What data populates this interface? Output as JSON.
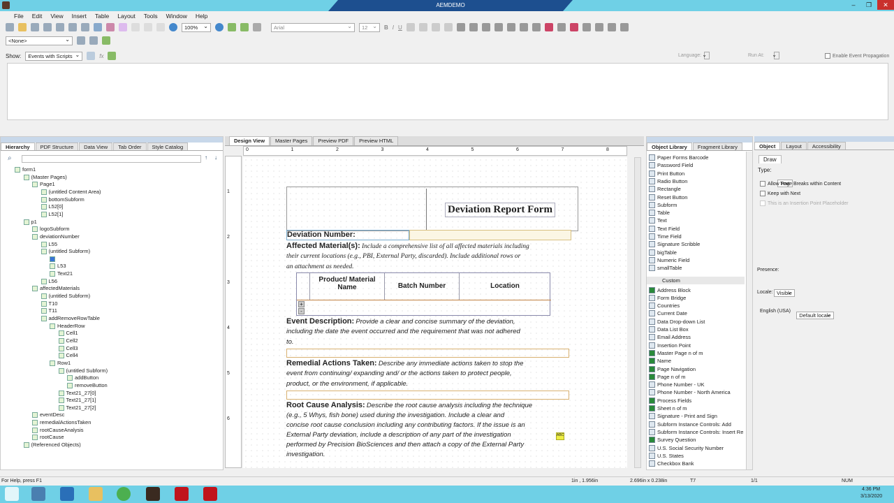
{
  "titlebar": {
    "title": "AEMDEMO"
  },
  "menu": [
    "File",
    "Edit",
    "View",
    "Insert",
    "Table",
    "Layout",
    "Tools",
    "Window",
    "Help"
  ],
  "toolbar": {
    "zoom": "100%",
    "font": "Arial",
    "font_size": "12",
    "bold": "B",
    "italic": "I",
    "underline": "U"
  },
  "toolbar2": {
    "style_select": "<None>"
  },
  "script_bar": {
    "show_label": "Show:",
    "show_value": "Events with Scripts",
    "language_label": "Language:",
    "run_at_label": "Run At:",
    "enable_propagation": "Enable Event Propagation"
  },
  "hierarchy": {
    "tabs": [
      "Hierarchy",
      "PDF Structure",
      "Data View",
      "Tab Order",
      "Style Catalog"
    ],
    "items": [
      [
        "form1",
        0
      ],
      [
        "(Master Pages)",
        1
      ],
      [
        "Page1",
        2
      ],
      [
        "(untitled Content Area)",
        3
      ],
      [
        "bottomSubform",
        3
      ],
      [
        "L52[0]",
        3
      ],
      [
        "L52[1]",
        3
      ],
      [
        "p1",
        1
      ],
      [
        "logoSubform",
        2
      ],
      [
        "deviationNumber",
        2
      ],
      [
        "L55",
        3
      ],
      [
        "(untitled Subform)",
        3
      ],
      [
        "",
        4
      ],
      [
        "L53",
        4
      ],
      [
        "Text21",
        4
      ],
      [
        "L56",
        3
      ],
      [
        "affectedMaterials",
        2
      ],
      [
        "(untitled Subform)",
        3
      ],
      [
        "T10",
        3
      ],
      [
        "T11",
        3
      ],
      [
        "addRemoveRowTable",
        3
      ],
      [
        "HeaderRow",
        4
      ],
      [
        "Cell1",
        5
      ],
      [
        "Cell2",
        5
      ],
      [
        "Cell3",
        5
      ],
      [
        "Cell4",
        5
      ],
      [
        "Row1",
        4
      ],
      [
        "(untitled Subform)",
        5
      ],
      [
        "addButton",
        6
      ],
      [
        "removeButton",
        6
      ],
      [
        "Text21_27[0]",
        5
      ],
      [
        "Text21_27[1]",
        5
      ],
      [
        "Text21_27[2]",
        5
      ],
      [
        "eventDesc",
        2
      ],
      [
        "remedialActionsTaken",
        2
      ],
      [
        "rootCauseAnalysis",
        2
      ],
      [
        "rootCause",
        2
      ],
      [
        "(Referenced Objects)",
        1
      ]
    ]
  },
  "design": {
    "tabs": [
      "Design View",
      "Master Pages",
      "Preview PDF",
      "Preview HTML"
    ],
    "ruler": [
      "0",
      "1",
      "2",
      "3",
      "4",
      "5",
      "6",
      "7",
      "8"
    ],
    "vruler": [
      "1",
      "2",
      "3",
      "4",
      "5",
      "6"
    ]
  },
  "form": {
    "title": "Deviation Report Form",
    "deviation_number": "Deviation Number:",
    "affected_label": "Affected Material(s):",
    "affected_text": [
      "Include a comprehensive list of all affected materials including",
      "their current locations (e.g., PBI, External Party, discarded).  Include additional rows or",
      "an attachment as needed."
    ],
    "table_headers": [
      "Product/ Material Name",
      "Batch Number",
      "Location"
    ],
    "add_btn": "+",
    "remove_btn": "-",
    "event_label": "Event Description:",
    "event_text": [
      "Provide a clear and concise summary of the deviation,",
      "including the date the event occurred and the requirement that was not adhered",
      "to."
    ],
    "remedial_label": "Remedial Actions Taken:",
    "remedial_text": [
      "Describe any immediate actions taken to stop the",
      "event from continuing/ expanding and/ or the actions taken to protect people,",
      "product, or the environment, if applicable."
    ],
    "root_label": "Root Cause Analysis:",
    "root_text": [
      "Describe the root cause analysis including the technique",
      "(e.g., 5 Whys, fish bone) used during the investigation.  Include a clear and",
      "concise root cause conclusion including any contributing factors.  If the issue is an",
      "External Party deviation, include a description of any part of the investigation",
      "performed by Precision BioSciences and then attach a copy of the External Party",
      "investigation."
    ],
    "spell_badge": "ABC"
  },
  "object_library": {
    "tabs": [
      "Object Library",
      "Fragment Library"
    ],
    "standard": [
      "Paper Forms Barcode",
      "Password Field",
      "Print Button",
      "Radio Button",
      "Rectangle",
      "Reset Button",
      "Subform",
      "Table",
      "Text",
      "Text Field",
      "Time Field",
      "Signature Scribble",
      "bigTable",
      "Numeric Field",
      "smallTable"
    ],
    "custom_header": "Custom",
    "custom": [
      "Address Block",
      "Form Bridge",
      "Countries",
      "Current Date",
      "Data Drop-down List",
      "Data List Box",
      "Email Address",
      "Insertion Point",
      "Master Page n of m",
      "Name",
      "Page Navigation",
      "Page n of m",
      "Phone Number - UK",
      "Phone Number - North America",
      "Process Fields",
      "Sheet n of m",
      "Signature - Print and Sign",
      "Subform Instance Controls: Add",
      "Subform Instance Controls: Insert Re",
      "Survey Question",
      "U.S. Social Security Number",
      "U.S. States",
      "Checkbox Bank"
    ]
  },
  "object_panel": {
    "tabs": [
      "Object",
      "Layout",
      "Accessibility"
    ],
    "subtab": "Draw",
    "type_label": "Type:",
    "type_value": "Text",
    "checks": [
      "Allow Page Breaks within Content",
      "Keep with Next",
      "This is an Insertion Point Placeholder"
    ],
    "presence_label": "Presence:",
    "presence_value": "Visible",
    "locale_label": "Locale:",
    "locale_value": "Default locale",
    "locale_note": "English (USA)"
  },
  "status": {
    "help": "For Help, press F1",
    "position": "1in , 1.956in",
    "size": "2.696in x 0.238in",
    "object": "T7",
    "page": "1/1",
    "num": "NUM"
  },
  "taskbar": {
    "time": "4:36 PM",
    "date": "3/13/2020"
  },
  "colors": {
    "titlebar": "#6fd0e6",
    "title_tab": "#1d4f8f",
    "close": "#c9302c"
  }
}
